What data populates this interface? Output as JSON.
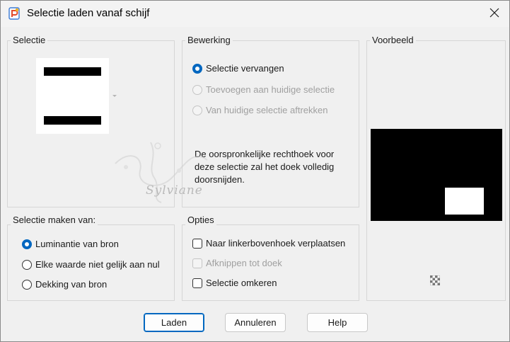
{
  "window": {
    "title": "Selectie laden vanaf schijf",
    "accent_color": "#0067c0"
  },
  "groups": {
    "selectie": {
      "label": "Selectie"
    },
    "bewerking": {
      "label": "Bewerking",
      "options": [
        {
          "label": "Selectie vervangen",
          "checked": true,
          "enabled": true
        },
        {
          "label": "Toevoegen aan huidige selectie",
          "checked": false,
          "enabled": false
        },
        {
          "label": "Van huidige selectie aftrekken",
          "checked": false,
          "enabled": false
        }
      ],
      "description": "De oorspronkelijke rechthoek voor deze selectie zal het doek volledig doorsnijden."
    },
    "voorbeeld": {
      "label": "Voorbeeld"
    },
    "selectie_maken_van": {
      "label": "Selectie maken van:",
      "options": [
        {
          "label": "Luminantie van bron",
          "checked": true
        },
        {
          "label": "Elke waarde niet gelijk aan nul",
          "checked": false
        },
        {
          "label": "Dekking van bron",
          "checked": false
        }
      ]
    },
    "opties": {
      "label": "Opties",
      "checkboxes": [
        {
          "label": "Naar linkerbovenhoek verplaatsen",
          "checked": false,
          "enabled": true
        },
        {
          "label": "Afknippen tot doek",
          "checked": false,
          "enabled": false
        },
        {
          "label": "Selectie omkeren",
          "checked": false,
          "enabled": true
        }
      ]
    }
  },
  "buttons": {
    "load": "Laden",
    "cancel": "Annuleren",
    "help": "Help"
  },
  "watermark_text": "Sylviane"
}
